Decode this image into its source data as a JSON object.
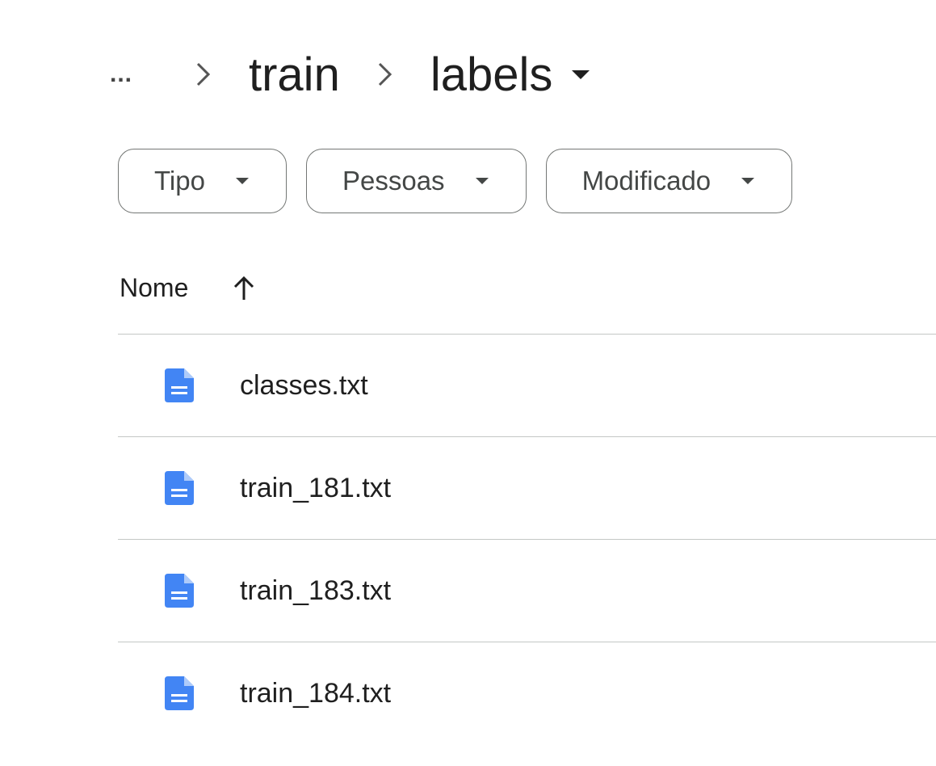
{
  "breadcrumb": {
    "overflow": "...",
    "items": [
      {
        "label": "train"
      },
      {
        "label": "labels"
      }
    ]
  },
  "filters": [
    {
      "label": "Tipo"
    },
    {
      "label": "Pessoas"
    },
    {
      "label": "Modificado"
    }
  ],
  "list_header": {
    "name_label": "Nome",
    "sort": "ascending"
  },
  "files": [
    {
      "name": "classes.txt",
      "icon": "doc-icon"
    },
    {
      "name": "train_181.txt",
      "icon": "doc-icon"
    },
    {
      "name": "train_183.txt",
      "icon": "doc-icon"
    },
    {
      "name": "train_184.txt",
      "icon": "doc-icon"
    }
  ],
  "colors": {
    "doc_icon": "#4285f4",
    "divider": "#c4c7c5",
    "chip_border": "#747775"
  }
}
